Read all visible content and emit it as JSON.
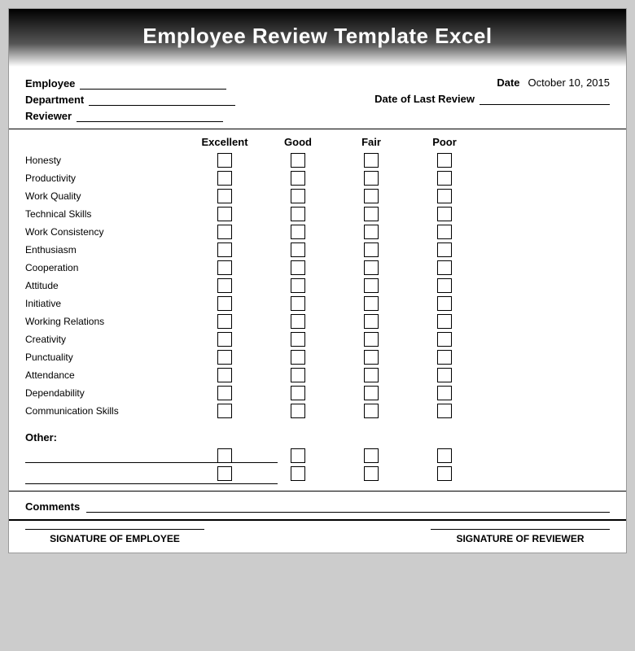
{
  "header": {
    "title": "Employee Review Template Excel"
  },
  "info": {
    "employee_label": "Employee",
    "department_label": "Department",
    "reviewer_label": "Reviewer",
    "date_label": "Date",
    "date_value": "October 10, 2015",
    "date_last_review_label": "Date of Last Review"
  },
  "ratings": {
    "columns": [
      "Excellent",
      "Good",
      "Fair",
      "Poor"
    ],
    "rows": [
      "Honesty",
      "Productivity",
      "Work Quality",
      "Technical Skills",
      "Work Consistency",
      "Enthusiasm",
      "Cooperation",
      "Attitude",
      "Initiative",
      "Working Relations",
      "Creativity",
      "Punctuality",
      "Attendance",
      "Dependability",
      "Communication Skills"
    ]
  },
  "other": {
    "label": "Other:",
    "num_rows": 2
  },
  "comments": {
    "label": "Comments"
  },
  "signatures": {
    "employee_label": "SIGNATURE OF EMPLOYEE",
    "reviewer_label": "SIGNATURE OF REVIEWER"
  }
}
